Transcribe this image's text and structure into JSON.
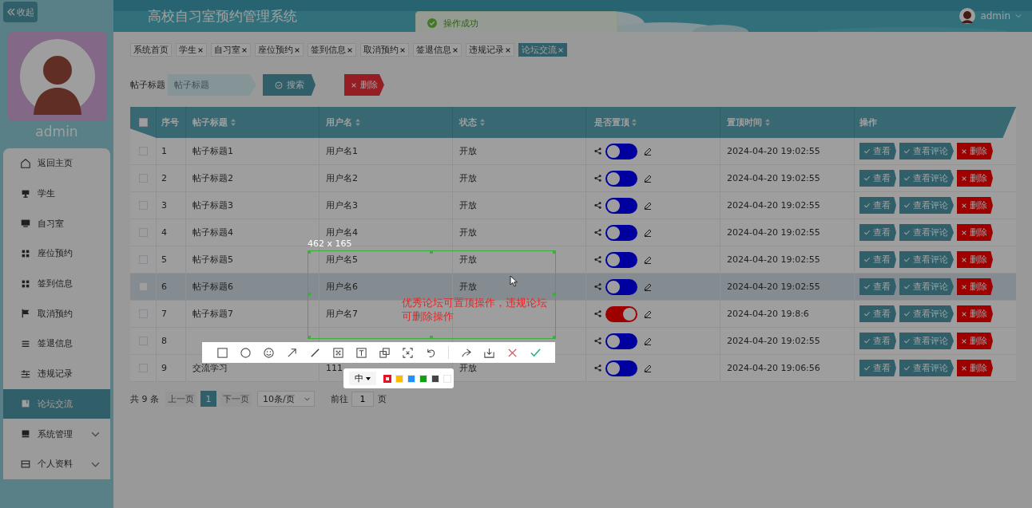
{
  "sidebar": {
    "collapse_button": "收起",
    "user_name": "admin",
    "menu": [
      {
        "label": "返回主页",
        "selected": false,
        "has_submenu": false
      },
      {
        "label": "学生",
        "selected": false,
        "has_submenu": false
      },
      {
        "label": "自习室",
        "selected": false,
        "has_submenu": false
      },
      {
        "label": "座位预约",
        "selected": false,
        "has_submenu": false
      },
      {
        "label": "签到信息",
        "selected": false,
        "has_submenu": false
      },
      {
        "label": "取消预约",
        "selected": false,
        "has_submenu": false
      },
      {
        "label": "签退信息",
        "selected": false,
        "has_submenu": false
      },
      {
        "label": "违规记录",
        "selected": false,
        "has_submenu": false
      },
      {
        "label": "论坛交流",
        "selected": true,
        "has_submenu": false
      },
      {
        "label": "系统管理",
        "selected": false,
        "has_submenu": true
      },
      {
        "label": "个人资料",
        "selected": false,
        "has_submenu": true
      }
    ]
  },
  "header": {
    "title": "高校自习室预约管理系统",
    "toast": "操作成功",
    "user_name": "admin"
  },
  "tabs": [
    {
      "label": "系统首页",
      "closable": false,
      "selected": false
    },
    {
      "label": "学生",
      "closable": true,
      "selected": false
    },
    {
      "label": "自习室",
      "closable": true,
      "selected": false
    },
    {
      "label": "座位预约",
      "closable": true,
      "selected": false
    },
    {
      "label": "签到信息",
      "closable": true,
      "selected": false
    },
    {
      "label": "取消预约",
      "closable": true,
      "selected": false
    },
    {
      "label": "签退信息",
      "closable": true,
      "selected": false
    },
    {
      "label": "违规记录",
      "closable": true,
      "selected": false
    },
    {
      "label": "论坛交流",
      "closable": true,
      "selected": true
    }
  ],
  "search": {
    "label": "帖子标题",
    "placeholder": "帖子标题",
    "search_button": "搜索",
    "delete_button": "删除"
  },
  "table": {
    "select_all_checked": false,
    "columns": [
      {
        "label": "序号",
        "sortable": false
      },
      {
        "label": "帖子标题",
        "sortable": true
      },
      {
        "label": "用户名",
        "sortable": true
      },
      {
        "label": "状态",
        "sortable": true
      },
      {
        "label": "是否置顶",
        "sortable": true
      },
      {
        "label": "置顶时间",
        "sortable": true
      },
      {
        "label": "操作",
        "sortable": false
      }
    ],
    "rows": [
      {
        "checked": false,
        "highlighted": false,
        "index": "1",
        "title": "帖子标题1",
        "user": "用户名1",
        "status": "开放",
        "pinned": false,
        "pin_time": "2024-04-20 19:02:55",
        "actions": [
          "查看",
          "查看评论",
          "删除"
        ]
      },
      {
        "checked": false,
        "highlighted": false,
        "index": "2",
        "title": "帖子标题2",
        "user": "用户名2",
        "status": "开放",
        "pinned": false,
        "pin_time": "2024-04-20 19:02:55",
        "actions": [
          "查看",
          "查看评论",
          "删除"
        ]
      },
      {
        "checked": false,
        "highlighted": false,
        "index": "3",
        "title": "帖子标题3",
        "user": "用户名3",
        "status": "开放",
        "pinned": false,
        "pin_time": "2024-04-20 19:02:55",
        "actions": [
          "查看",
          "查看评论",
          "删除"
        ]
      },
      {
        "checked": false,
        "highlighted": false,
        "index": "4",
        "title": "帖子标题4",
        "user": "用户名4",
        "status": "开放",
        "pinned": false,
        "pin_time": "2024-04-20 19:02:55",
        "actions": [
          "查看",
          "查看评论",
          "删除"
        ]
      },
      {
        "checked": false,
        "highlighted": false,
        "index": "5",
        "title": "帖子标题5",
        "user": "用户名5",
        "status": "开放",
        "pinned": false,
        "pin_time": "2024-04-20 19:02:55",
        "actions": [
          "查看",
          "查看评论",
          "删除"
        ]
      },
      {
        "checked": false,
        "highlighted": true,
        "index": "6",
        "title": "帖子标题6",
        "user": "用户名6",
        "status": "开放",
        "pinned": false,
        "pin_time": "2024-04-20 19:02:55",
        "actions": [
          "查看",
          "查看评论",
          "删除"
        ]
      },
      {
        "checked": false,
        "highlighted": false,
        "index": "7",
        "title": "帖子标题7",
        "user": "用户名7",
        "pinned": true,
        "pin_time": "2024-04-20 19:8:6",
        "actions": [
          "查看",
          "查看评论",
          "删除"
        ]
      },
      {
        "checked": false,
        "highlighted": false,
        "index": "8",
        "pinned": false,
        "pin_time": "2024-04-20 19:02:55",
        "actions": [
          "查看",
          "查看评论",
          "删除"
        ]
      },
      {
        "checked": false,
        "highlighted": false,
        "index": "9",
        "title": "交流学习",
        "user": "111",
        "status": "开放",
        "pinned": false,
        "pin_time": "2024-04-20 19:06:56",
        "actions": [
          "查看",
          "查看评论",
          "删除"
        ]
      }
    ]
  },
  "pagination": {
    "total": "共 9 条",
    "prev": "上一页",
    "pages": [
      {
        "label": "1",
        "selected": true
      }
    ],
    "next": "下一页",
    "page_size": "10条/页",
    "goto_label": "前往",
    "goto_value": "1",
    "goto_suffix": "页"
  },
  "capture_tool": {
    "size_label": "462 x 165",
    "annotation": "优秀论坛可置顶操作，违规论坛可删除操作",
    "font_size": "中",
    "swatches": [
      {
        "color": "#e81123",
        "selected": true
      },
      {
        "color": "#ffb900",
        "selected": false
      },
      {
        "color": "#1e90ff",
        "selected": false
      },
      {
        "color": "#10a010",
        "selected": false
      },
      {
        "color": "#444444",
        "selected": false
      },
      {
        "color": "#ffffff",
        "selected": false
      }
    ]
  }
}
